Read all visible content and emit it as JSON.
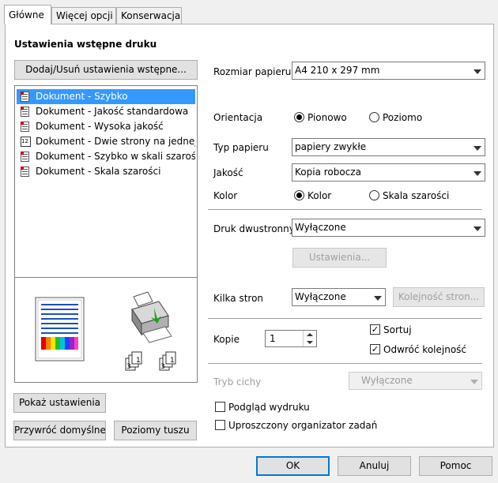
{
  "tabs": [
    {
      "label": "Główne"
    },
    {
      "label": "Więcej opcji"
    },
    {
      "label": "Konserwacja"
    }
  ],
  "presets": {
    "title": "Ustawienia wstępne druku",
    "add_remove_button": "Dodaj/Usuń ustawienia wstępne...",
    "items": [
      {
        "label": "Dokument - Szybko",
        "selected": true,
        "icon": "document-icon"
      },
      {
        "label": "Dokument - Jakość standardowa",
        "icon": "document-icon"
      },
      {
        "label": "Dokument - Wysoka jakość",
        "icon": "document-icon"
      },
      {
        "label": "Dokument - Dwie strony na jednej",
        "icon": "two-up-icon"
      },
      {
        "label": "Dokument - Szybko w skali szarości",
        "icon": "document-icon"
      },
      {
        "label": "Dokument - Skala szarości",
        "icon": "document-icon"
      }
    ]
  },
  "preview": {
    "page_icon": "page-preview-icon",
    "printer_icon": "printer-icon",
    "copies_icon": "collate-order-icon",
    "collate_label_a": "3",
    "collate_label_b": "1"
  },
  "settings": {
    "paper_size_label": "Rozmiar papieru",
    "paper_size_value": "A4 210 x 297 mm",
    "orientation_label": "Orientacja",
    "orientation_portrait": "Pionowo",
    "orientation_landscape": "Poziomo",
    "orientation_selected": "Pionowo",
    "paper_type_label": "Typ papieru",
    "paper_type_value": "papiery zwykłe",
    "quality_label": "Jakość",
    "quality_value": "Kopia robocza",
    "color_label": "Kolor",
    "color_color": "Kolor",
    "color_gray": "Skala szarości",
    "color_selected": "Kolor",
    "duplex_label": "Druk dwustronny",
    "duplex_value": "Wyłączone",
    "duplex_settings_button": "Ustawienia...",
    "multipage_label": "Kilka stron",
    "multipage_value": "Wyłączone",
    "page_order_button": "Kolejność stron...",
    "copies_label": "Kopie",
    "copies_value": "1",
    "collate_label": "Sortuj",
    "collate_checked": true,
    "reverse_label": "Odwróć kolejność",
    "reverse_checked": true,
    "quiet_label": "Tryb cichy",
    "quiet_value": "Wyłączone",
    "print_preview_label": "Podgląd wydruku",
    "print_preview_checked": false,
    "job_arranger_label": "Uproszczony organizator zadań",
    "job_arranger_checked": false
  },
  "left_buttons": {
    "show_settings": "Pokaż ustawienia",
    "restore_defaults": "Przywróć domyślne",
    "ink_levels": "Poziomy tuszu"
  },
  "footer": {
    "ok": "OK",
    "cancel": "Anuluj",
    "help": "Pomoc"
  }
}
